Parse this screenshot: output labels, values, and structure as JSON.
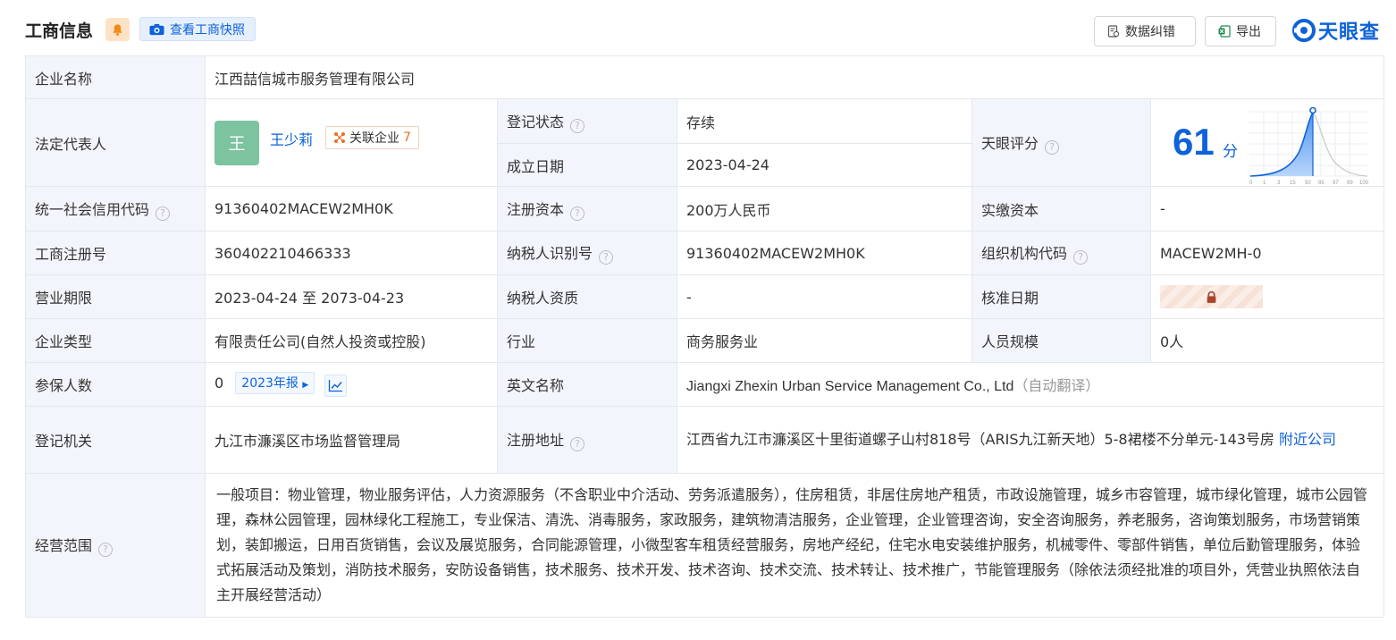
{
  "header": {
    "title": "工商信息",
    "snapshot_label": "查看工商快照",
    "correct_label": "数据纠错",
    "export_label": "导出",
    "brand": "天眼查"
  },
  "table": {
    "company_name": {
      "label": "企业名称",
      "value": "江西喆信城市服务管理有限公司"
    },
    "legal_rep": {
      "label": "法定代表人",
      "avatar": "王",
      "name": "王少莉",
      "related_label": "关联企业",
      "related_count": "7"
    },
    "reg_status": {
      "label": "登记状态",
      "value": "存续"
    },
    "found_date": {
      "label": "成立日期",
      "value": "2023-04-24"
    },
    "score": {
      "label": "天眼评分",
      "value": "61",
      "unit": "分",
      "axis_ticks": [
        "0",
        "1",
        "3",
        "15",
        "50",
        "85",
        "97",
        "99",
        "100"
      ]
    },
    "credit_code": {
      "label": "统一社会信用代码",
      "value": "91360402MACEW2MH0K"
    },
    "reg_capital": {
      "label": "注册资本",
      "value": "200万人民币"
    },
    "paid_capital": {
      "label": "实缴资本",
      "value": "-"
    },
    "reg_number": {
      "label": "工商注册号",
      "value": "360402210466333"
    },
    "taxpayer_id": {
      "label": "纳税人识别号",
      "value": "91360402MACEW2MH0K"
    },
    "org_code": {
      "label": "组织机构代码",
      "value": "MACEW2MH-0"
    },
    "business_term": {
      "label": "营业期限",
      "value": "2023-04-24 至 2073-04-23"
    },
    "taxpayer_qual": {
      "label": "纳税人资质",
      "value": "-"
    },
    "approval_date": {
      "label": "核准日期"
    },
    "company_type": {
      "label": "企业类型",
      "value": "有限责任公司(自然人投资或控股)"
    },
    "industry": {
      "label": "行业",
      "value": "商务服务业"
    },
    "staff_size": {
      "label": "人员规模",
      "value": "0人"
    },
    "insured": {
      "label": "参保人数",
      "value": "0",
      "report": "2023年报"
    },
    "english_name": {
      "label": "英文名称",
      "value": "Jiangxi Zhexin Urban Service Management Co., Ltd",
      "note": "（自动翻译）"
    },
    "reg_authority": {
      "label": "登记机关",
      "value": "九江市濂溪区市场监督管理局"
    },
    "reg_address": {
      "label": "注册地址",
      "value": "江西省九江市濂溪区十里街道螺子山村818号（ARIS九江新天地）5-8裙楼不分单元-143号房",
      "nearby": "附近公司"
    },
    "business_scope": {
      "label": "经营范围",
      "value": "一般项目：物业管理，物业服务评估，人力资源服务（不含职业中介活动、劳务派遣服务），住房租赁，非居住房地产租赁，市政设施管理，城乡市容管理，城市绿化管理，城市公园管理，森林公园管理，园林绿化工程施工，专业保洁、清洗、消毒服务，家政服务，建筑物清洁服务，企业管理，企业管理咨询，安全咨询服务，养老服务，咨询策划服务，市场营销策划，装卸搬运，日用百货销售，会议及展览服务，合同能源管理，小微型客车租赁经营服务，房地产经纪，住宅水电安装维护服务，机械零件、零部件销售，单位后勤管理服务，体验式拓展活动及策划，消防技术服务，安防设备销售，技术服务、技术开发、技术咨询、技术交流、技术转让、技术推广，节能管理服务（除依法须经批准的项目外，凭营业执照依法自主开展经营活动）"
    }
  },
  "colors": {
    "accent": "#0e62d9",
    "label_bg": "#f2f6fc",
    "status_green": "#17a34a"
  }
}
